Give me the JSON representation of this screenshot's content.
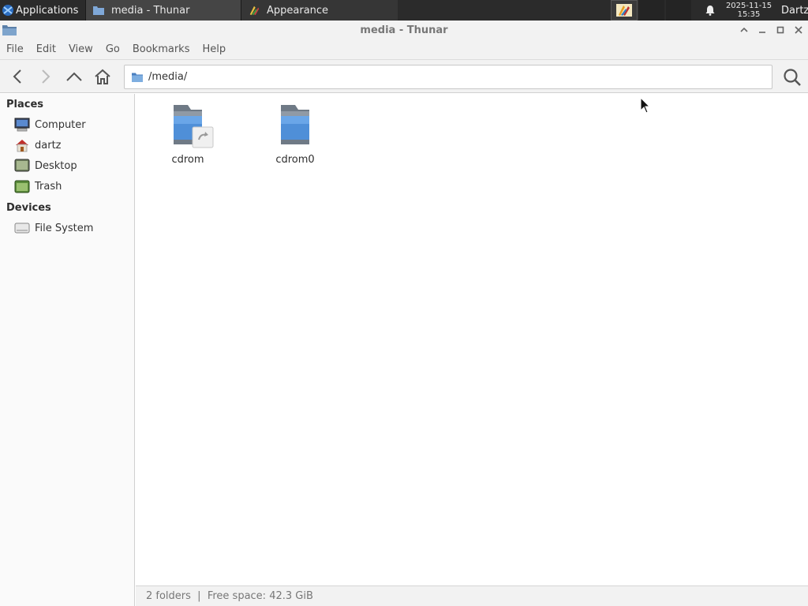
{
  "panel": {
    "applications_label": "Applications",
    "tasks": [
      {
        "label": "media - Thunar"
      },
      {
        "label": "Appearance"
      }
    ],
    "clock_date": "2025-11-15",
    "clock_time": "15:35",
    "user": "Dartz"
  },
  "window": {
    "title": "media - Thunar"
  },
  "menu": [
    "File",
    "Edit",
    "View",
    "Go",
    "Bookmarks",
    "Help"
  ],
  "location": {
    "path": "/media/"
  },
  "sidebar": {
    "places_heading": "Places",
    "places": [
      {
        "label": "Computer",
        "icon": "computer-icon"
      },
      {
        "label": "dartz",
        "icon": "home-icon"
      },
      {
        "label": "Desktop",
        "icon": "desktop-icon"
      },
      {
        "label": "Trash",
        "icon": "trash-icon"
      }
    ],
    "devices_heading": "Devices",
    "devices": [
      {
        "label": "File System",
        "icon": "drive-icon"
      }
    ]
  },
  "files": [
    {
      "name": "cdrom",
      "icon": "folder-symlink-icon"
    },
    {
      "name": "cdrom0",
      "icon": "folder-icon"
    }
  ],
  "status": {
    "text": "2 folders  |  Free space: 42.3 GiB"
  },
  "colors": {
    "panel_bg": "#2b2b2b",
    "folder_blue": "#4a8fd6",
    "window_bg": "#f2f2f2"
  }
}
